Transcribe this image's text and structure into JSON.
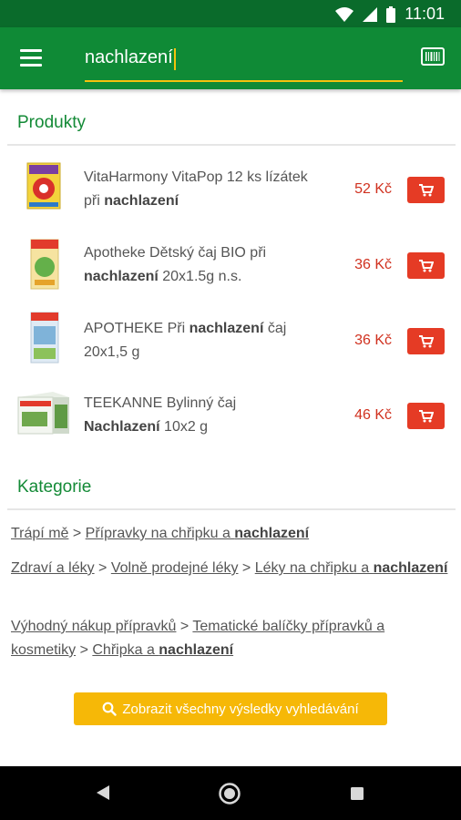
{
  "status_bar": {
    "time": "11:01"
  },
  "search": {
    "value": "nachlazení"
  },
  "sections": {
    "products": "Produkty",
    "categories": "Kategorie"
  },
  "products": [
    {
      "name_pre": "VitaHarmony VitaPop 12 ks lízátek při ",
      "name_bold": "nachlazení",
      "name_post": "",
      "price": "52 Kč"
    },
    {
      "name_pre": "Apotheke Dětský čaj BIO při ",
      "name_bold": "nachlazení",
      "name_post": " 20x1.5g n.s.",
      "price": "36 Kč"
    },
    {
      "name_pre": "APOTHEKE Při ",
      "name_bold": "nachlazení",
      "name_post": " čaj 20x1,5 g",
      "price": "36 Kč"
    },
    {
      "name_pre": "TEEKANNE Bylinný čaj ",
      "name_bold": "Nachlazení",
      "name_post": " 10x2 g",
      "price": "46 Kč"
    }
  ],
  "categories": [
    {
      "c1": "Trápí mě",
      "sep1": " > ",
      "c2_pre": "Přípravky na chřipku a ",
      "c2_bold": "nachlazení"
    },
    {
      "c1": "Zdraví a léky",
      "sep1": " > ",
      "c2": "Volně prodejné léky",
      "sep2": " > ",
      "c3_pre": "Léky na chřipku a ",
      "c3_bold": "nachlazení"
    },
    {
      "c1": "Výhodný nákup přípravků",
      "sep1": " > ",
      "c2": "Tematické balíčky přípravků a kosmetiky",
      "sep2": " > ",
      "c3_pre": "Chřipka a ",
      "c3_bold": "nachlazení"
    }
  ],
  "show_all_label": "Zobrazit všechny výsledky vyhledávání",
  "colors": {
    "appbar": "#0f8a36",
    "accent": "#f4c20d",
    "price": "#d0311f",
    "cart": "#e53b25",
    "section": "#138a36"
  }
}
